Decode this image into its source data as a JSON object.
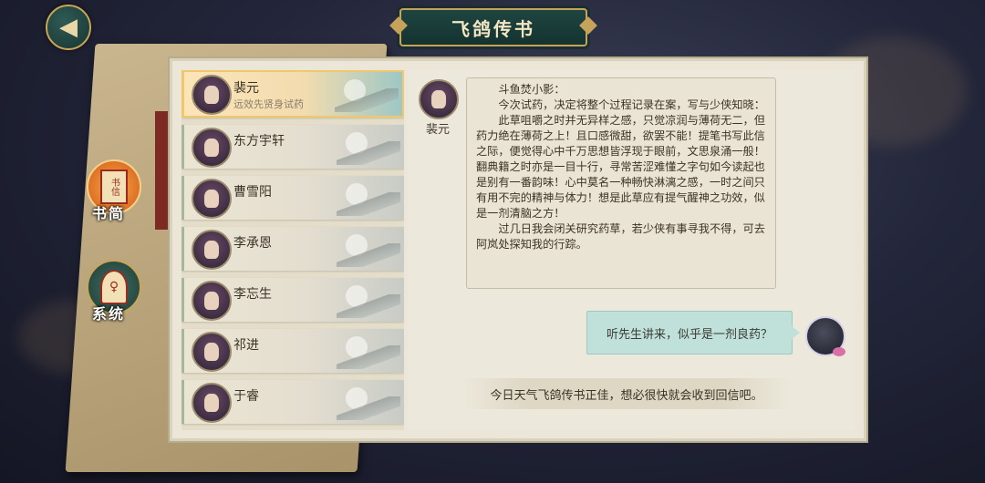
{
  "header": {
    "title": "飞鸽传书"
  },
  "nav": {
    "back_glyph": "◀",
    "letters_label": "书简",
    "letters_icon_text": "书信",
    "system_label": "系统",
    "system_icon_text": "♀"
  },
  "contacts": [
    {
      "name": "裴元",
      "subtitle": "远效先贤身试药",
      "active": true
    },
    {
      "name": "东方宇轩",
      "subtitle": ""
    },
    {
      "name": "曹雪阳",
      "subtitle": ""
    },
    {
      "name": "李承恩",
      "subtitle": ""
    },
    {
      "name": "李忘生",
      "subtitle": ""
    },
    {
      "name": "祁进",
      "subtitle": ""
    },
    {
      "name": "于睿",
      "subtitle": ""
    }
  ],
  "chat": {
    "npc_name": "裴元",
    "letter": {
      "salutation": "斗鱼焚小影：",
      "paragraph1": "今次试药，决定将整个过程记录在案，写与少侠知晓：",
      "paragraph2": "此草咀嚼之时并无异样之感，只觉凉润与薄荷无二，但药力绝在薄荷之上！且口感微甜，欲罢不能！提笔书写此信之际，便觉得心中千万思想皆浮现于眼前，文思泉涌一般！翻典籍之时亦是一目十行，寻常苦涩难懂之字句如今读起也是别有一番韵味！心中莫名一种畅快淋漓之感，一时之间只有用不完的精神与体力！想是此草应有提气醒神之功效，似是一剂清脑之方！",
      "paragraph3": "过几日我会闭关研究药草，若少侠有事寻我不得，可去阿岚处探知我的行踪。"
    },
    "player_message": "听先生讲来，似乎是一剂良药？",
    "status": "今日天气飞鸽传书正佳，想必很快就会收到回信吧。"
  }
}
